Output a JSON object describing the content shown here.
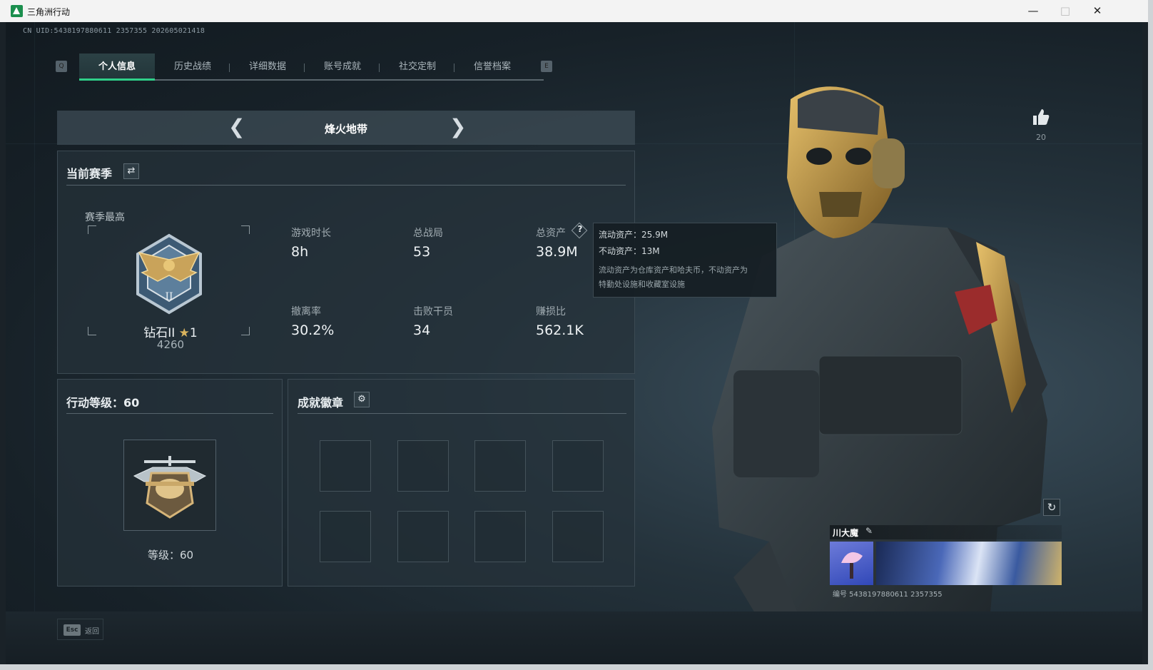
{
  "window": {
    "title": "三角洲行动",
    "controls": [
      "minimize",
      "maximize",
      "close"
    ]
  },
  "uid": "CN UID:5438197880611 2357355 202605021418",
  "tabs": [
    {
      "label": "个人信息",
      "active": true
    },
    {
      "label": "历史战绩",
      "active": false
    },
    {
      "label": "详细数据",
      "active": false
    },
    {
      "label": "账号成就",
      "active": false
    },
    {
      "label": "社交定制",
      "active": false
    },
    {
      "label": "信誉档案",
      "active": false
    }
  ],
  "tab_keys": {
    "left": "Q",
    "right": "E"
  },
  "mode_selector": {
    "name": "烽火地带"
  },
  "season": {
    "title": "当前赛季",
    "best_label": "赛季最高",
    "rank_name": "钻石II",
    "rank_stars": "1",
    "rank_points": "4260",
    "stats": [
      {
        "label": "游戏时长",
        "value": "8h"
      },
      {
        "label": "总战局",
        "value": "53"
      },
      {
        "label": "总资产",
        "value": "38.9M",
        "has_help": true
      },
      {
        "label": "撤离率",
        "value": "30.2%"
      },
      {
        "label": "击败干员",
        "value": "34"
      },
      {
        "label": "赚损比",
        "value": "562.1K"
      }
    ]
  },
  "asset_tooltip": {
    "liquid": "流动资产：25.9M",
    "fixed": "不动资产：13M",
    "note_line1": "流动资产为仓库资产和哈夫币，不动资产为",
    "note_line2": "特勤处设施和收藏室设施"
  },
  "level_panel": {
    "title": "行动等级：60",
    "level_text": "等级：60"
  },
  "achievements": {
    "title": "成就徽章",
    "slot_count": 8
  },
  "likes": {
    "count": "20"
  },
  "profile": {
    "name": "川大魔",
    "id_text": "编号 5438197880611 2357355"
  },
  "footer": {
    "key": "Esc",
    "label": "返回"
  },
  "colors": {
    "accent": "#2fd089",
    "gold": "#c9a35a",
    "panel": "#26323a"
  }
}
